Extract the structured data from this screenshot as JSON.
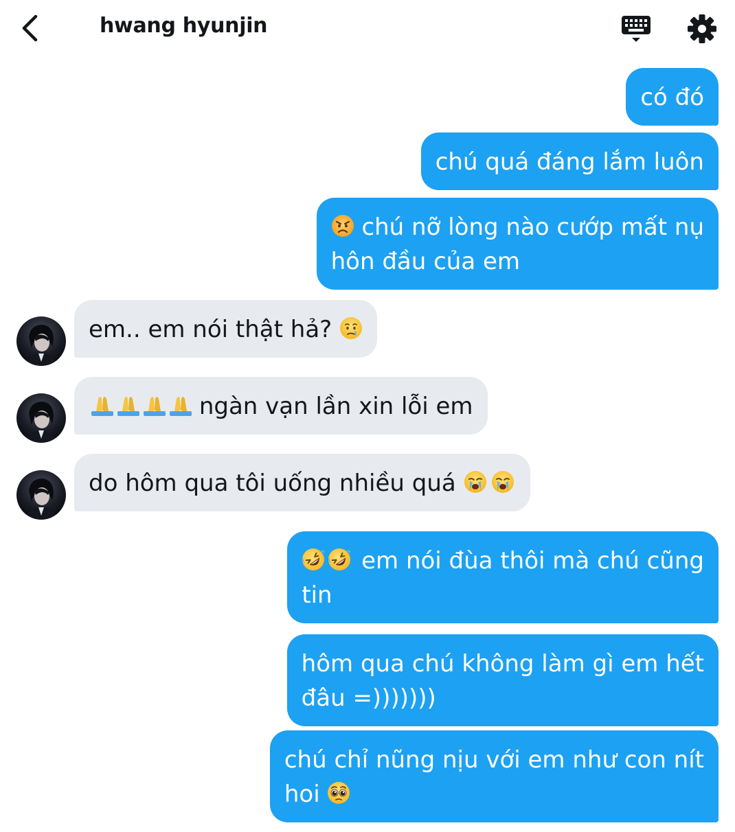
{
  "header": {
    "title": "hwang hyunjin",
    "back_icon": "chevron-left-icon",
    "keyboard_icon": "keyboard-icon",
    "settings_icon": "gear-icon"
  },
  "colors": {
    "sent_bubble": "#1da1f2",
    "received_bubble": "#e7ebf0",
    "text_dark": "#14171a"
  },
  "messages": [
    {
      "from": "me",
      "lines": [
        "có đó"
      ]
    },
    {
      "from": "me",
      "lines": [
        "chú quá đáng lắm luôn"
      ]
    },
    {
      "from": "me",
      "emoji": "angry-face",
      "lines": [
        "chú nỡ lòng nào cướp mất nụ",
        "hôn đầu của em"
      ]
    },
    {
      "from": "them",
      "emoji": "crying-face",
      "lines": [
        "em.. em nói thật hả?"
      ]
    },
    {
      "from": "them",
      "emoji": "folded-hands",
      "lines": [
        "ngàn vạn lần xin lỗi em"
      ]
    },
    {
      "from": "them",
      "emoji": "loudly-crying-face",
      "lines": [
        "do hôm qua tôi uống nhiều quá"
      ]
    },
    {
      "from": "me",
      "emoji": "rolling-laughing-face",
      "lines": [
        "em nói đùa thôi mà chú cũng",
        "tin"
      ]
    },
    {
      "from": "me",
      "lines": [
        "hôm qua chú không làm gì em hết",
        "đâu =)))))))"
      ]
    },
    {
      "from": "me",
      "emoji": "pleading-face",
      "lines": [
        "chú chỉ nũng nịu với em như con nít",
        "hoi"
      ]
    }
  ]
}
